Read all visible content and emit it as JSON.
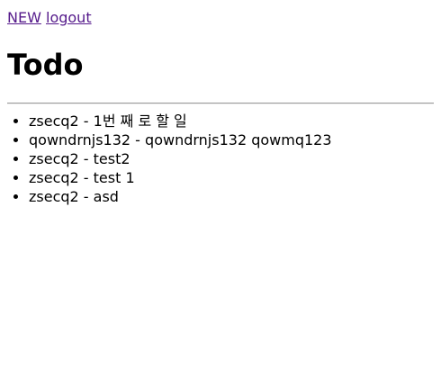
{
  "nav": {
    "new_label": "NEW",
    "logout_label": "logout"
  },
  "page": {
    "title": "Todo"
  },
  "todos": [
    {
      "text": "zsecq2 - 1번 째 로 할 일"
    },
    {
      "text": "qowndrnjs132 - qowndrnjs132 qowmq123"
    },
    {
      "text": "zsecq2 - test2"
    },
    {
      "text": "zsecq2 - test 1"
    },
    {
      "text": "zsecq2 - asd"
    }
  ],
  "colors": {
    "link_visited": "#551a8b",
    "divider": "#9a9a9a",
    "background": "#ffffff",
    "text": "#000000"
  }
}
